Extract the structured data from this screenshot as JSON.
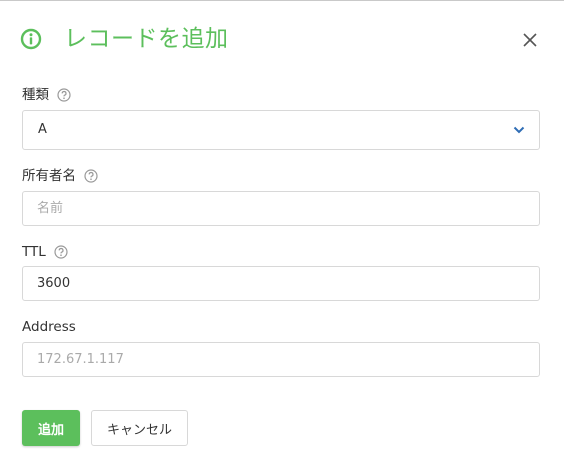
{
  "dialog": {
    "title": "レコードを追加"
  },
  "form": {
    "type": {
      "label": "種類",
      "value": "A"
    },
    "owner": {
      "label": "所有者名",
      "placeholder": "名前",
      "value": ""
    },
    "ttl": {
      "label": "TTL",
      "value": "3600"
    },
    "address": {
      "label": "Address",
      "placeholder": "172.67.1.117",
      "value": ""
    }
  },
  "buttons": {
    "add": "追加",
    "cancel": "キャンセル"
  },
  "icons": {
    "title": "info-icon",
    "close": "close-icon",
    "help": "help-circle-icon",
    "dropdown": "chevron-down-icon"
  },
  "colors": {
    "accent": "#5cbf5c",
    "chevron": "#2f6db5",
    "border": "#d8d8d8"
  }
}
